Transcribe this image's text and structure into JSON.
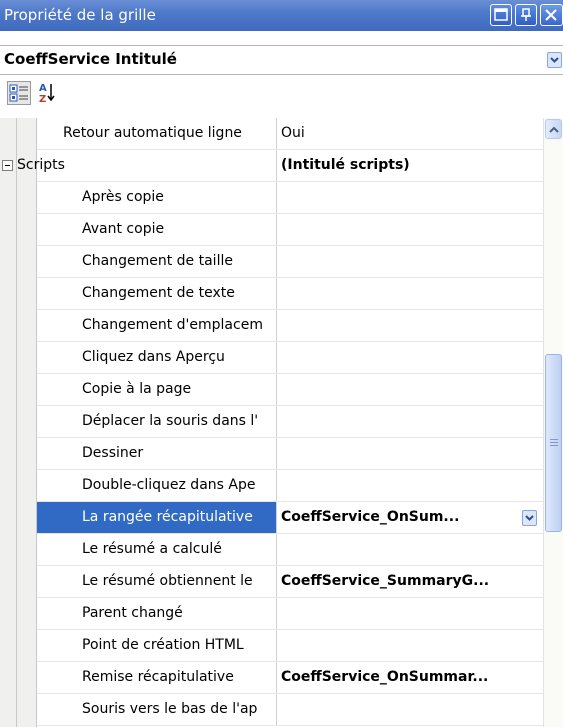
{
  "window": {
    "title": "Propriété de la grille"
  },
  "selector": {
    "value": "CoeffService  Intitulé"
  },
  "toolbar": {
    "categorized_icon": "categorized-icon",
    "alphabetical_icon": "sort-az-icon"
  },
  "grid": {
    "rows": [
      {
        "name": "Retour automatique ligne",
        "value": "Oui",
        "indent": 1
      },
      {
        "name": "Scripts",
        "value": "(Intitulé scripts)",
        "category": true,
        "bold": true
      },
      {
        "name": "Après copie",
        "value": "",
        "indent": 2
      },
      {
        "name": "Avant copie",
        "value": "",
        "indent": 2
      },
      {
        "name": "Changement de taille",
        "value": "",
        "indent": 2
      },
      {
        "name": "Changement de texte",
        "value": "",
        "indent": 2
      },
      {
        "name": "Changement d'emplacem",
        "value": "",
        "indent": 2
      },
      {
        "name": "Cliquez dans Aperçu",
        "value": "",
        "indent": 2
      },
      {
        "name": "Copie à la page",
        "value": "",
        "indent": 2
      },
      {
        "name": "Déplacer la souris dans l'",
        "value": "",
        "indent": 2
      },
      {
        "name": "Dessiner",
        "value": "",
        "indent": 2
      },
      {
        "name": "Double-cliquez dans Ape",
        "value": "",
        "indent": 2
      },
      {
        "name": "La rangée récapitulative",
        "value": "CoeffService_OnSum...",
        "indent": 2,
        "selected": true
      },
      {
        "name": "Le résumé a calculé",
        "value": "",
        "indent": 2
      },
      {
        "name": "Le résumé obtiennent le",
        "value": "CoeffService_SummaryG...",
        "indent": 2,
        "bold": true
      },
      {
        "name": "Parent changé",
        "value": "",
        "indent": 2
      },
      {
        "name": "Point de création HTML",
        "value": "",
        "indent": 2
      },
      {
        "name": "Remise récapitulative",
        "value": "CoeffService_OnSummar...",
        "indent": 2,
        "bold": true
      },
      {
        "name": "Souris vers le bas de l'ap",
        "value": "",
        "indent": 2
      }
    ]
  }
}
